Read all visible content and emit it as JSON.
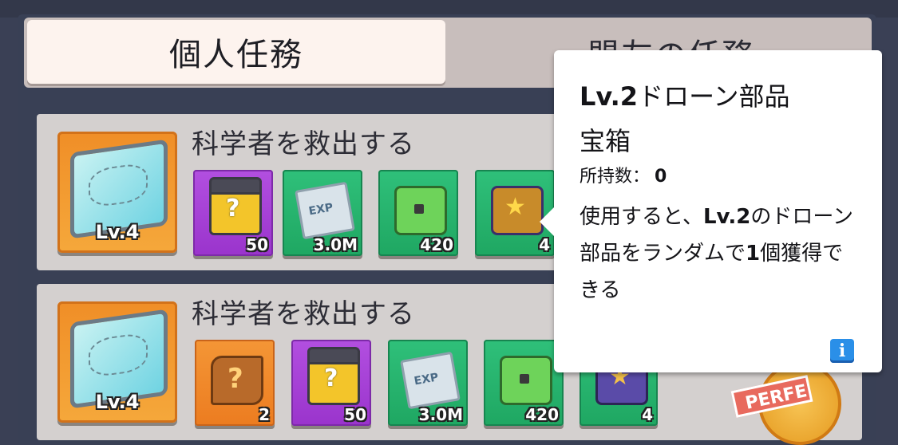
{
  "tabs": [
    {
      "label": "個人任務",
      "active": true
    },
    {
      "label": "盟友の任務",
      "active": false
    }
  ],
  "missions": [
    {
      "title": "科学者を救出する",
      "icon_level": "Lv.4",
      "rewards": [
        {
          "icon": "mystery-box-icon",
          "qty": "50"
        },
        {
          "icon": "exp-paper-icon",
          "qty": "3.0M"
        },
        {
          "icon": "green-chest-icon",
          "qty": "420"
        },
        {
          "icon": "drone-parts-chest-icon",
          "qty": "4"
        }
      ]
    },
    {
      "title": "科学者を救出する",
      "icon_level": "Lv.4",
      "rewards": [
        {
          "icon": "puzzle-piece-icon",
          "qty": "2"
        },
        {
          "icon": "mystery-box-icon",
          "qty": "50"
        },
        {
          "icon": "exp-paper-icon",
          "qty": "3.0M"
        },
        {
          "icon": "green-chest-icon",
          "qty": "420"
        },
        {
          "icon": "drone-parts-chest-icon",
          "qty": "4"
        }
      ]
    }
  ],
  "badge": {
    "text": "PERFE"
  },
  "tooltip": {
    "title_bold": "Lv.2",
    "title_rest_line1": "ドローン部品",
    "title_line2": "宝箱",
    "own_label": "所持数：",
    "own_value": "0",
    "desc_part1": "使用すると、",
    "desc_bold1": "Lv.2",
    "desc_part2": "のドローン部品をランダムで",
    "desc_bold2": "1",
    "desc_part3": "個獲得できる",
    "info_icon": "i"
  },
  "colors": {
    "background": "#3a4055",
    "tab_active": "#fdf3ee",
    "row_bg": "#d4d0cf",
    "purple_tile": "#a83fd8",
    "green_tile": "#22b06a",
    "orange_tile": "#f08a2c",
    "info_blue": "#2a8fe8"
  }
}
